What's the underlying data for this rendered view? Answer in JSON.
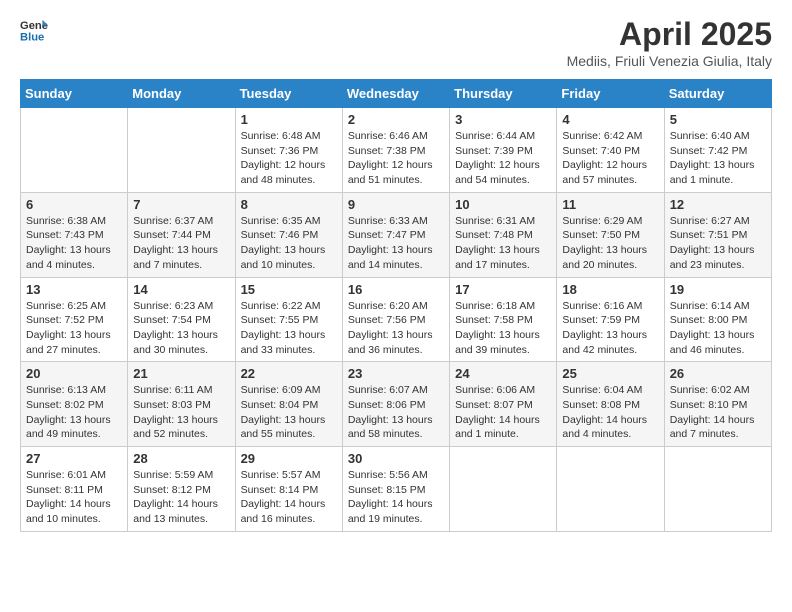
{
  "logo": {
    "general": "General",
    "blue": "Blue"
  },
  "title": "April 2025",
  "subtitle": "Mediis, Friuli Venezia Giulia, Italy",
  "weekdays": [
    "Sunday",
    "Monday",
    "Tuesday",
    "Wednesday",
    "Thursday",
    "Friday",
    "Saturday"
  ],
  "weeks": [
    [
      {
        "day": "",
        "info": ""
      },
      {
        "day": "",
        "info": ""
      },
      {
        "day": "1",
        "info": "Sunrise: 6:48 AM\nSunset: 7:36 PM\nDaylight: 12 hours and 48 minutes."
      },
      {
        "day": "2",
        "info": "Sunrise: 6:46 AM\nSunset: 7:38 PM\nDaylight: 12 hours and 51 minutes."
      },
      {
        "day": "3",
        "info": "Sunrise: 6:44 AM\nSunset: 7:39 PM\nDaylight: 12 hours and 54 minutes."
      },
      {
        "day": "4",
        "info": "Sunrise: 6:42 AM\nSunset: 7:40 PM\nDaylight: 12 hours and 57 minutes."
      },
      {
        "day": "5",
        "info": "Sunrise: 6:40 AM\nSunset: 7:42 PM\nDaylight: 13 hours and 1 minute."
      }
    ],
    [
      {
        "day": "6",
        "info": "Sunrise: 6:38 AM\nSunset: 7:43 PM\nDaylight: 13 hours and 4 minutes."
      },
      {
        "day": "7",
        "info": "Sunrise: 6:37 AM\nSunset: 7:44 PM\nDaylight: 13 hours and 7 minutes."
      },
      {
        "day": "8",
        "info": "Sunrise: 6:35 AM\nSunset: 7:46 PM\nDaylight: 13 hours and 10 minutes."
      },
      {
        "day": "9",
        "info": "Sunrise: 6:33 AM\nSunset: 7:47 PM\nDaylight: 13 hours and 14 minutes."
      },
      {
        "day": "10",
        "info": "Sunrise: 6:31 AM\nSunset: 7:48 PM\nDaylight: 13 hours and 17 minutes."
      },
      {
        "day": "11",
        "info": "Sunrise: 6:29 AM\nSunset: 7:50 PM\nDaylight: 13 hours and 20 minutes."
      },
      {
        "day": "12",
        "info": "Sunrise: 6:27 AM\nSunset: 7:51 PM\nDaylight: 13 hours and 23 minutes."
      }
    ],
    [
      {
        "day": "13",
        "info": "Sunrise: 6:25 AM\nSunset: 7:52 PM\nDaylight: 13 hours and 27 minutes."
      },
      {
        "day": "14",
        "info": "Sunrise: 6:23 AM\nSunset: 7:54 PM\nDaylight: 13 hours and 30 minutes."
      },
      {
        "day": "15",
        "info": "Sunrise: 6:22 AM\nSunset: 7:55 PM\nDaylight: 13 hours and 33 minutes."
      },
      {
        "day": "16",
        "info": "Sunrise: 6:20 AM\nSunset: 7:56 PM\nDaylight: 13 hours and 36 minutes."
      },
      {
        "day": "17",
        "info": "Sunrise: 6:18 AM\nSunset: 7:58 PM\nDaylight: 13 hours and 39 minutes."
      },
      {
        "day": "18",
        "info": "Sunrise: 6:16 AM\nSunset: 7:59 PM\nDaylight: 13 hours and 42 minutes."
      },
      {
        "day": "19",
        "info": "Sunrise: 6:14 AM\nSunset: 8:00 PM\nDaylight: 13 hours and 46 minutes."
      }
    ],
    [
      {
        "day": "20",
        "info": "Sunrise: 6:13 AM\nSunset: 8:02 PM\nDaylight: 13 hours and 49 minutes."
      },
      {
        "day": "21",
        "info": "Sunrise: 6:11 AM\nSunset: 8:03 PM\nDaylight: 13 hours and 52 minutes."
      },
      {
        "day": "22",
        "info": "Sunrise: 6:09 AM\nSunset: 8:04 PM\nDaylight: 13 hours and 55 minutes."
      },
      {
        "day": "23",
        "info": "Sunrise: 6:07 AM\nSunset: 8:06 PM\nDaylight: 13 hours and 58 minutes."
      },
      {
        "day": "24",
        "info": "Sunrise: 6:06 AM\nSunset: 8:07 PM\nDaylight: 14 hours and 1 minute."
      },
      {
        "day": "25",
        "info": "Sunrise: 6:04 AM\nSunset: 8:08 PM\nDaylight: 14 hours and 4 minutes."
      },
      {
        "day": "26",
        "info": "Sunrise: 6:02 AM\nSunset: 8:10 PM\nDaylight: 14 hours and 7 minutes."
      }
    ],
    [
      {
        "day": "27",
        "info": "Sunrise: 6:01 AM\nSunset: 8:11 PM\nDaylight: 14 hours and 10 minutes."
      },
      {
        "day": "28",
        "info": "Sunrise: 5:59 AM\nSunset: 8:12 PM\nDaylight: 14 hours and 13 minutes."
      },
      {
        "day": "29",
        "info": "Sunrise: 5:57 AM\nSunset: 8:14 PM\nDaylight: 14 hours and 16 minutes."
      },
      {
        "day": "30",
        "info": "Sunrise: 5:56 AM\nSunset: 8:15 PM\nDaylight: 14 hours and 19 minutes."
      },
      {
        "day": "",
        "info": ""
      },
      {
        "day": "",
        "info": ""
      },
      {
        "day": "",
        "info": ""
      }
    ]
  ]
}
